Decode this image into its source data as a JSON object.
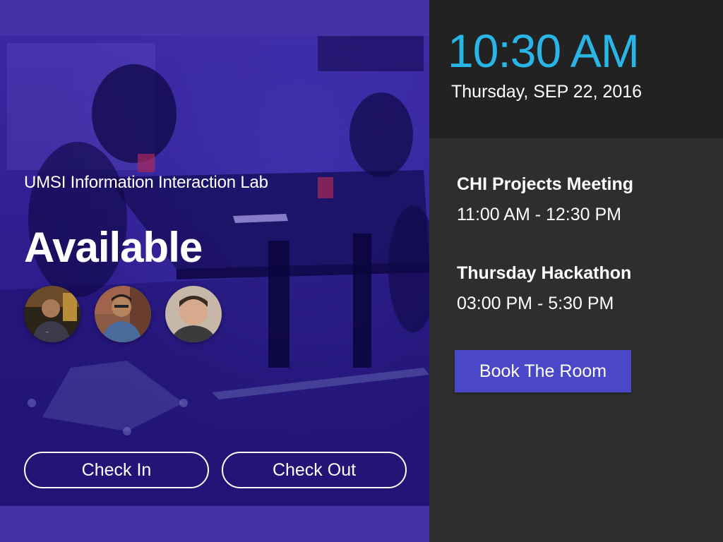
{
  "room": {
    "name": "UMSI Information Interaction Lab",
    "status": "Available",
    "attendees": [
      {
        "icon": "person-avatar"
      },
      {
        "icon": "person-avatar"
      },
      {
        "icon": "person-avatar"
      }
    ]
  },
  "actions": {
    "check_in_label": "Check In",
    "check_out_label": "Check Out"
  },
  "clock": {
    "time": "10:30 AM",
    "date": "Thursday, SEP 22, 2016"
  },
  "schedule": [
    {
      "title": "CHI Projects Meeting",
      "time": "11:00 AM - 12:30 PM"
    },
    {
      "title": "Thursday Hackathon",
      "time": "03:00 PM - 5:30 PM"
    }
  ],
  "book": {
    "label": "Book The Room"
  },
  "colors": {
    "left_panel": "#4631a8",
    "clock_text": "#29b6e6",
    "book_button": "#4a48c9",
    "right_panel": "#2e2e2e",
    "clock_area": "#222222"
  }
}
